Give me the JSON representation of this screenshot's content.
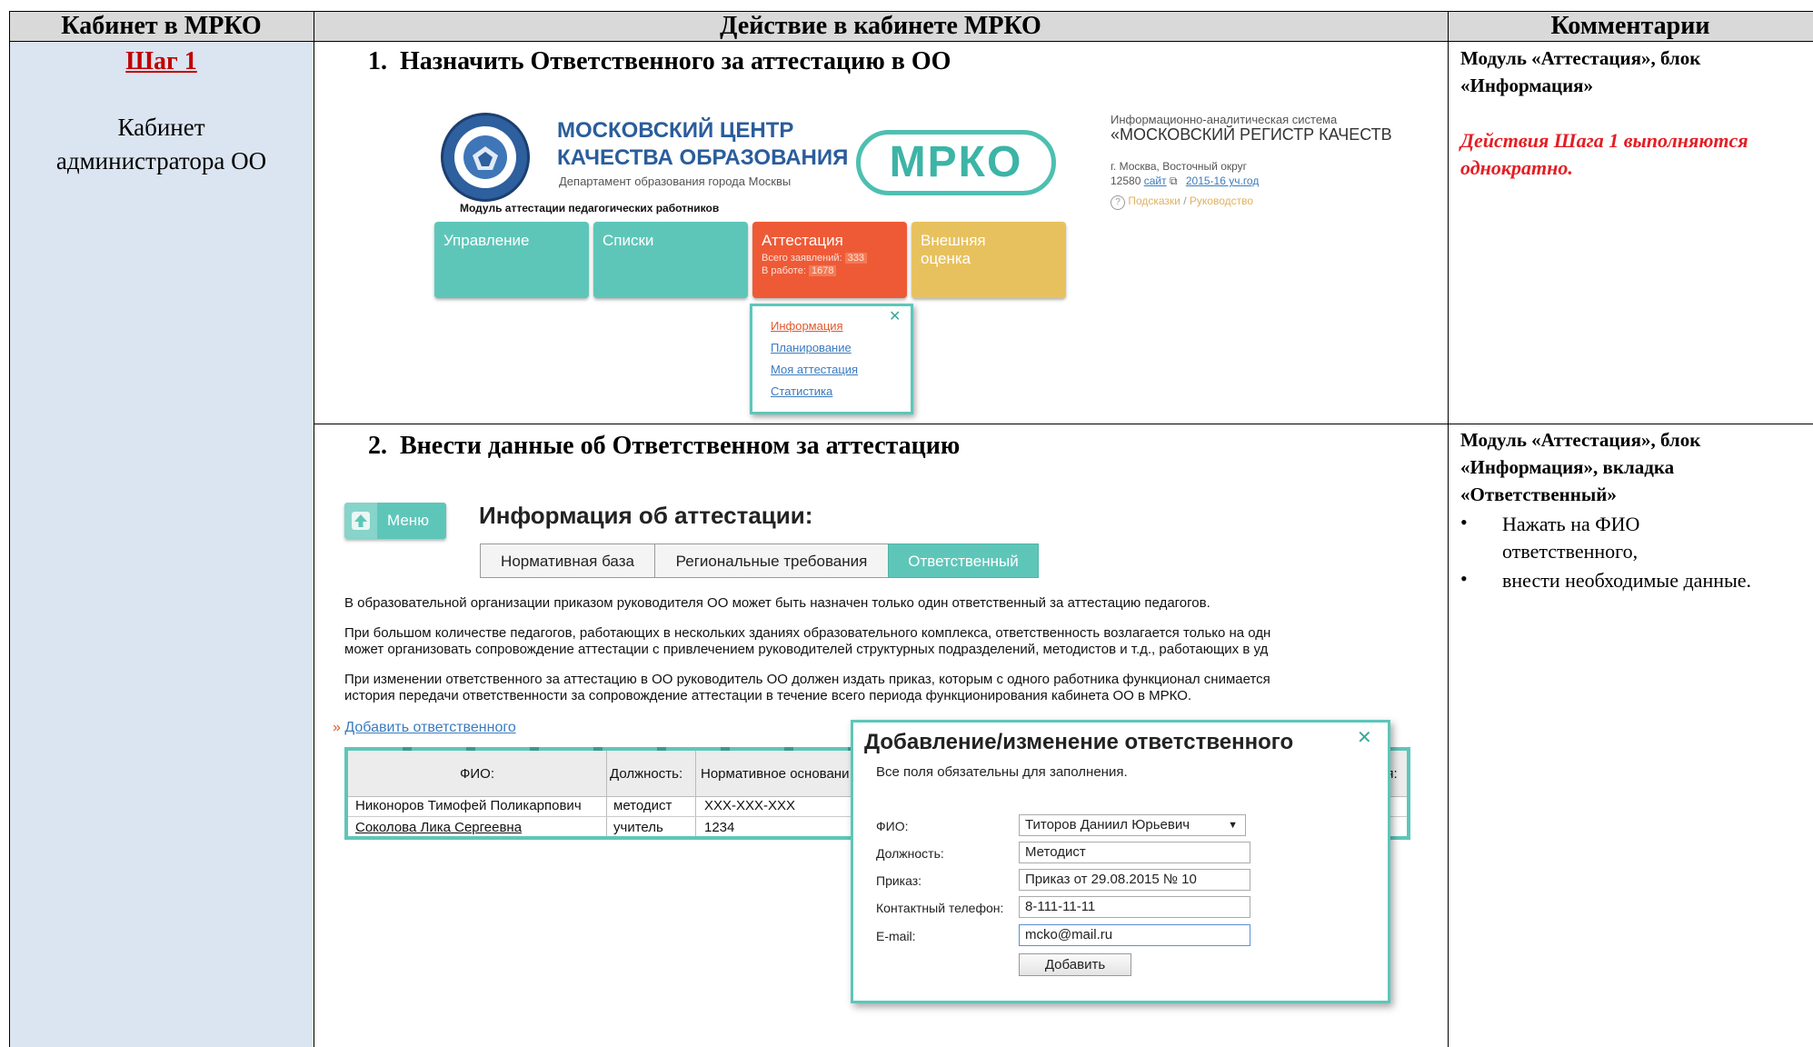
{
  "headers": {
    "col1": "Кабинет в МРКО",
    "col2": "Действие в кабинете МРКО",
    "col3": "Комментарии"
  },
  "left": {
    "step": "Шаг 1",
    "cabinet_line1": "Кабинет",
    "cabinet_line2": "администратора ОО"
  },
  "step1": {
    "title": "1.  Назначить Ответственного за аттестацию в ОО",
    "logo": {
      "line1": "МОСКОВСКИЙ ЦЕНТР",
      "line2": "КАЧЕСТВА ОБРАЗОВАНИЯ",
      "line3": "Департамент образования города Москвы",
      "seal_text": "МОСКОВСКИЙ ЦЕНТР КАЧЕСТВА ОБРАЗОВАНИЯ"
    },
    "mrko": "МРКО",
    "info": {
      "line1": "Информационно-аналитическая система",
      "line2": "«МОСКОВСКИЙ РЕГИСТР КАЧЕСТВ",
      "line3": "г. Москва, Восточный округ",
      "line4_prefix": "12580",
      "site_link": "сайт",
      "year_link": "2015-16 уч.год",
      "help_link": "Подсказки",
      "slash": "/",
      "manual_link": "Руководство"
    },
    "module_title": "Модуль аттестации педагогических работников",
    "tiles": {
      "t1": "Управление",
      "t2": "Списки",
      "t3": "Аттестация",
      "t3_s1_label": "Всего заявлений:",
      "t3_s1_value": "333",
      "t3_s2_label": "В работе:",
      "t3_s2_value": "1678",
      "t4_line1": "Внешняя",
      "t4_line2": "оценка"
    },
    "menu": {
      "close": "✕",
      "items": [
        "Информация",
        "Планирование",
        "Моя аттестация",
        "Статистика"
      ]
    }
  },
  "step2": {
    "title": "2.  Внести данные об Ответственном за аттестацию",
    "menu_btn": "Меню",
    "page_title": "Информация об аттестации:",
    "tabs": [
      "Нормативная база",
      "Региональные требования",
      "Ответственный"
    ],
    "para1": "В образовательной организации приказом руководителя ОО может быть назначен только один ответственный за аттестацию педагогов.",
    "para2_l1": "При большом количестве педагогов, работающих в нескольких зданиях образовательного комплекса, ответственность возлагается только на одн",
    "para2_l2": "может организовать сопровождение аттестации с привлечением руководителей структурных подразделений, методистов и т.д., работающих в уд",
    "para3_l1": "При изменении ответственного за аттестацию в ОО руководитель ОО должен издать приказ, которым с одного работника функционал снимается",
    "para3_l2": "история передачи ответственности за сопровождение аттестации в течение всего периода функционирования кабинета ОО в МРКО.",
    "add_arrow": "»",
    "add_link": "Добавить ответственного",
    "table": {
      "headers": [
        "ФИО:",
        "Должность:",
        "Нормативное основани",
        "ия:"
      ],
      "rows": [
        [
          "Никоноров Тимофей Поликарпович",
          "методист",
          "XXX-XXX-XXX"
        ],
        [
          "Соколова Лика Сергеевна",
          "учитель",
          "1234"
        ]
      ]
    },
    "modal": {
      "title": "Добавление/изменение ответственного",
      "close": "✕",
      "note": "Все поля обязательны для заполнения.",
      "labels": [
        "ФИО:",
        "Должность:",
        "Приказ:",
        "Контактный телефон:",
        "E-mail:"
      ],
      "fio_value": "Титоров Даниил Юрьевич",
      "fio_arrow": "▼",
      "position_value": "Методист",
      "order_value": "Приказ от 29.08.2015 № 10",
      "phone_value": "8-111-11-11",
      "email_value": "mcko@mail.ru",
      "submit": "Добавить"
    }
  },
  "comments": {
    "c1_line1": "Модуль «Аттестация», блок",
    "c1_line2": "«Информация»",
    "c1_red1": "Действия Шага 1 выполняются",
    "c1_red2": "однократно.",
    "c2_line1": "Модуль «Аттестация», блок",
    "c2_line2": "«Информация», вкладка",
    "c2_line3": "«Ответственный»",
    "bullet_symbol": "•",
    "b1_line1": "Нажать на ФИО",
    "b1_line2": "ответственного,",
    "b2": "внести необходимые данные."
  },
  "colors": {
    "teal": "#5ec6b9",
    "orange": "#ee5a36",
    "yellow": "#e8c15f",
    "red_text": "#e31e24",
    "header_gray": "#d9d9d9",
    "left_blue": "#dbe5f1"
  }
}
